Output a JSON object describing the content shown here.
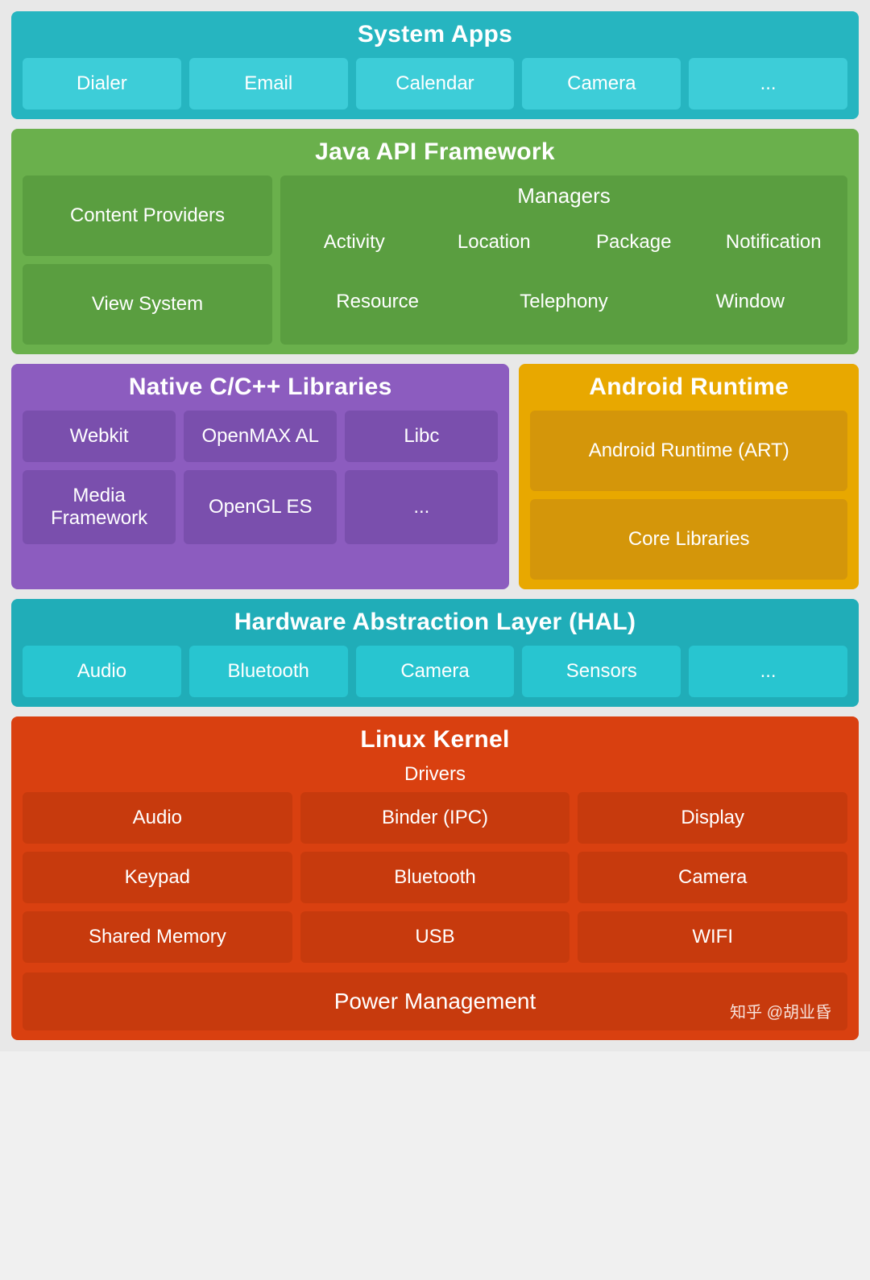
{
  "sysapps": {
    "title": "System Apps",
    "items": [
      "Dialer",
      "Email",
      "Calendar",
      "Camera",
      "..."
    ]
  },
  "java": {
    "title": "Java API Framework",
    "left_items": [
      "Content Providers",
      "View System"
    ],
    "managers_title": "Managers",
    "managers_row1": [
      "Activity",
      "Location",
      "Package",
      "Notification"
    ],
    "managers_row2": [
      "Resource",
      "Telephony",
      "Window"
    ]
  },
  "native": {
    "title": "Native C/C++ Libraries",
    "row1": [
      "Webkit",
      "OpenMAX AL",
      "Libc"
    ],
    "row2": [
      "Media Framework",
      "OpenGL ES",
      "..."
    ]
  },
  "runtime": {
    "title": "Android Runtime",
    "row1": "Android Runtime (ART)",
    "row2": "Core Libraries"
  },
  "hal": {
    "title": "Hardware Abstraction Layer (HAL)",
    "items": [
      "Audio",
      "Bluetooth",
      "Camera",
      "Sensors",
      "..."
    ]
  },
  "kernel": {
    "title": "Linux Kernel",
    "drivers_title": "Drivers",
    "drivers_row1": [
      "Audio",
      "Binder (IPC)",
      "Display"
    ],
    "drivers_row2": [
      "Keypad",
      "Bluetooth",
      "Camera"
    ],
    "drivers_row3": [
      "Shared Memory",
      "USB",
      "WIFI"
    ],
    "power": "Power Management",
    "watermark": "知乎 @胡业昏"
  }
}
